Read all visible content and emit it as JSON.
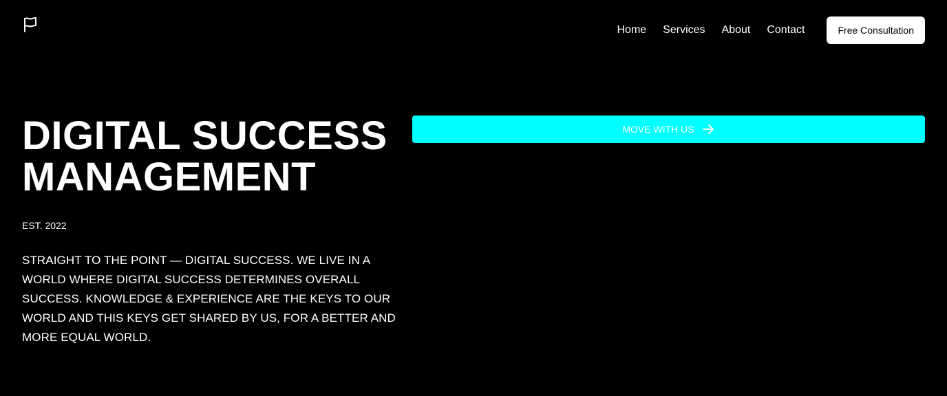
{
  "header": {
    "logo_icon": "flag-icon",
    "nav": [
      {
        "label": "Home"
      },
      {
        "label": "Services"
      },
      {
        "label": "About"
      },
      {
        "label": "Contact"
      }
    ],
    "cta_label": "Free Consultation"
  },
  "hero": {
    "title_line1": "DIGITAL SUCCESS",
    "title_line2": "MANAGEMENT",
    "established": "EST. 2022",
    "description": "STRAIGHT TO THE POINT — DIGITAL SUCCESS. WE LIVE IN A WORLD WHERE DIGITAL SUCCESS DETERMINES OVERALL SUCCESS. KNOWLEDGE & EXPERIENCE ARE THE KEYS TO OUR WORLD AND THIS KEYS GET SHARED BY US, FOR A BETTER AND MORE EQUAL WORLD.",
    "action_label": "MOVE WITH US",
    "action_icon": "arrow-right-icon"
  },
  "colors": {
    "background": "#000000",
    "text": "#ffffff",
    "accent": "#00ffff",
    "cta_background": "#ffffff",
    "cta_text": "#000000"
  }
}
